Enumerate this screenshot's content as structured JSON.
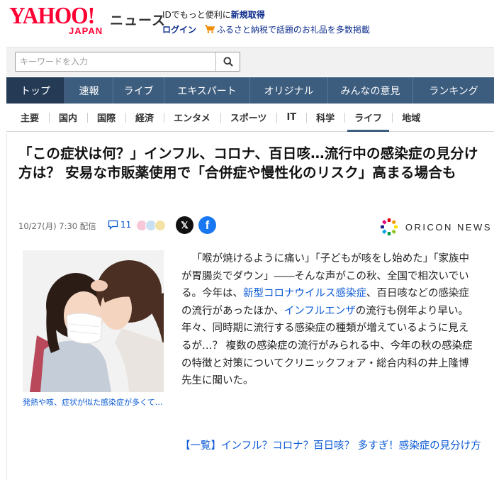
{
  "header": {
    "logo_text": "YAHOO!",
    "logo_sub": "JAPAN",
    "section_label": "ニュース",
    "promo_prefix": "IDでもっと便利に",
    "promo_link": "新規取得",
    "login": "ログイン",
    "furusato": "ふるさと納税で話題のお礼品を多数掲載"
  },
  "search": {
    "placeholder": "キーワードを入力"
  },
  "main_nav": [
    "トップ",
    "速報",
    "ライブ",
    "エキスパート",
    "オリジナル",
    "みんなの意見",
    "ランキング"
  ],
  "main_nav_active": "トップ",
  "sub_nav": [
    "主要",
    "国内",
    "国際",
    "経済",
    "エンタメ",
    "スポーツ",
    "IT",
    "科学",
    "ライフ",
    "地域"
  ],
  "sub_nav_active": "ライフ",
  "article": {
    "title": "「この症状は何？」インフル、コロナ、百日咳…流行中の感染症の見分け方は？ 安易な市販薬使用で「合併症や慢性化のリスク」高まる場合も",
    "date": "10/27(月) 7:30 配信",
    "comment_count": "11",
    "source": "ORICON NEWS",
    "caption": "発熱や咳、症状が似た感染症が多くて…",
    "body": {
      "p1": "「喉が焼けるように痛い」「子どもが咳をし始めた」「家族中が胃腸炎でダウン」――そんな声がこの秋、全国で相次いでいる。今年は、",
      "link1": "新型コロナウイルス感染症",
      "p2": "、百日咳などの感染症の流行があったほか、",
      "link2": "インフルエンザ",
      "p3": "の流行も例年より早い。年々、同時期に流行する感染症の種類が増えているように見えるが…？ 複数の感染症の流行がみられる中、今年の秋の感染症の特徴と対策についてクリニックフォア・総合内科の井上隆博先生に聞いた。"
    },
    "related": "【一覧】インフル？コロナ？百日咳？ 多すぎ！感染症の見分け方"
  },
  "colors": {
    "brand": "#ff0033",
    "nav_bg": "#3d5d7f",
    "nav_active": "#243a55",
    "link": "#0b5ad6"
  }
}
